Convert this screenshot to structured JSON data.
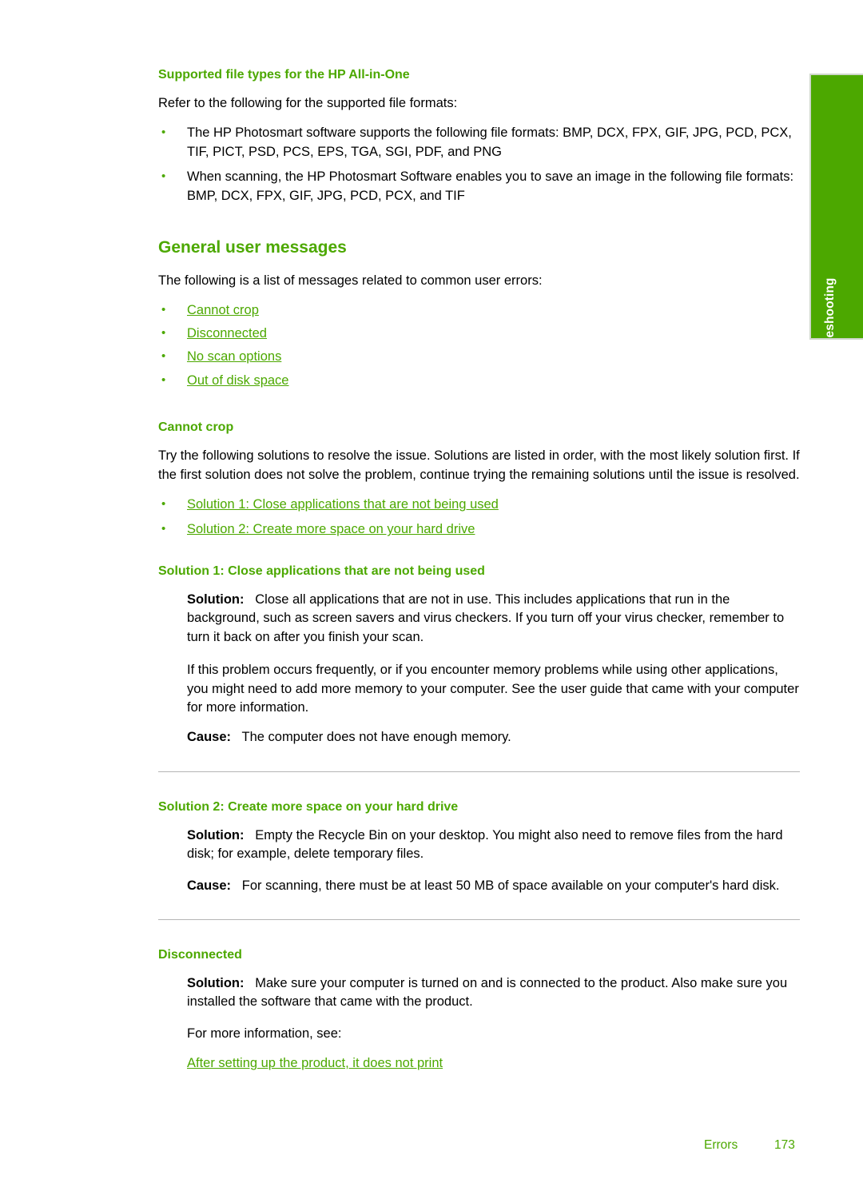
{
  "page": {
    "thumb_tab_label": "Troubleshooting",
    "accent_color": "#4CA800",
    "text_color": "#000000",
    "divider_color": "#b5b5b5"
  },
  "sections": {
    "supported_file_types": {
      "heading": "Supported file types for the HP All-in-One",
      "intro": "Refer to the following for the supported file formats:",
      "bullets": [
        "The HP Photosmart software supports the following file formats: BMP, DCX, FPX, GIF, JPG, PCD, PCX, TIF, PICT, PSD, PCS, EPS, TGA, SGI, PDF, and PNG",
        "When scanning, the HP Photosmart Software enables you to save an image in the following file formats: BMP, DCX, FPX, GIF, JPG, PCD, PCX, and TIF"
      ]
    },
    "general_user_messages": {
      "heading": "General user messages",
      "intro": "The following is a list of messages related to common user errors:",
      "links": [
        "Cannot crop",
        "Disconnected",
        "No scan options",
        "Out of disk space"
      ]
    },
    "cannot_crop": {
      "heading": "Cannot crop",
      "intro": "Try the following solutions to resolve the issue. Solutions are listed in order, with the most likely solution first. If the first solution does not solve the problem, continue trying the remaining solutions until the issue is resolved.",
      "links": [
        "Solution 1: Close applications that are not being used",
        "Solution 2: Create more space on your hard drive"
      ]
    },
    "solution_1": {
      "heading": "Solution 1: Close applications that are not being used",
      "solution_label": "Solution:",
      "solution_text": "Close all applications that are not in use. This includes applications that run in the background, such as screen savers and virus checkers. If you turn off your virus checker, remember to turn it back on after you finish your scan.",
      "extra_paragraph": "If this problem occurs frequently, or if you encounter memory problems while using other applications, you might need to add more memory to your computer. See the user guide that came with your computer for more information.",
      "cause_label": "Cause:",
      "cause_text": "The computer does not have enough memory."
    },
    "solution_2": {
      "heading": "Solution 2: Create more space on your hard drive",
      "solution_label": "Solution:",
      "solution_text": "Empty the Recycle Bin on your desktop. You might also need to remove files from the hard disk; for example, delete temporary files.",
      "cause_label": "Cause:",
      "cause_text": "For scanning, there must be at least 50 MB of space available on your computer's hard disk."
    },
    "disconnected": {
      "heading": "Disconnected",
      "solution_label": "Solution:",
      "solution_text": "Make sure your computer is turned on and is connected to the product. Also make sure you installed the software that came with the product.",
      "more_info": "For more information, see:",
      "link": "After setting up the product, it does not print"
    }
  },
  "footer": {
    "chapter": "Errors",
    "page_number": "173"
  }
}
